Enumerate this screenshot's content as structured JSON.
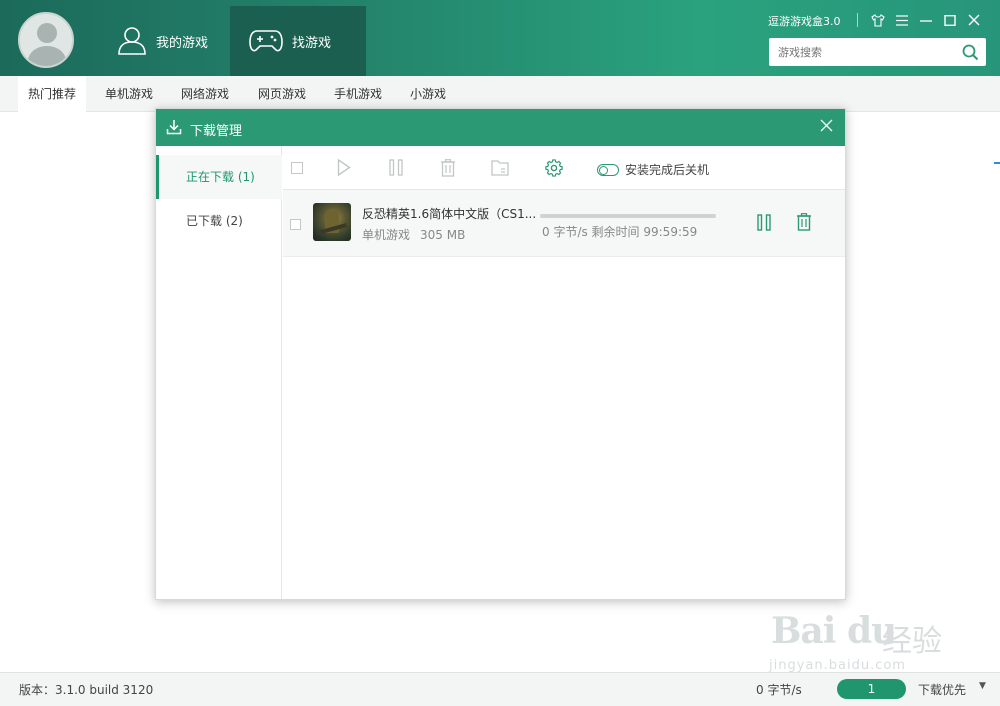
{
  "header": {
    "nav": [
      {
        "label": "我的游戏"
      },
      {
        "label": "找游戏"
      }
    ],
    "app_title": "逗游游戏盒3.0",
    "search": {
      "placeholder": "游戏搜索"
    }
  },
  "subnav": {
    "tabs": [
      {
        "label": "热门推荐"
      },
      {
        "label": "单机游戏"
      },
      {
        "label": "网络游戏"
      },
      {
        "label": "网页游戏"
      },
      {
        "label": "手机游戏"
      },
      {
        "label": "小游戏"
      }
    ]
  },
  "dialog": {
    "title": "下载管理",
    "sidebar": [
      {
        "label": "正在下载 (1)"
      },
      {
        "label": "已下载 (2)"
      }
    ],
    "toolbar": {
      "shutdown_label": "安装完成后关机"
    },
    "items": [
      {
        "name": "反恐精英1.6简体中文版（CS1...",
        "category": "单机游戏",
        "size": "305 MB",
        "status": "0 字节/s 剩余时间 99:59:59",
        "progress": 0
      }
    ]
  },
  "statusbar": {
    "version": "版本：3.1.0 build 3120",
    "speed": "0 字节/s",
    "count": "1",
    "priority": "下载优先"
  },
  "watermark": {
    "text": "Bai du",
    "cn": "经验",
    "url": "jingyan.baidu.com"
  },
  "colors": {
    "brand_green": "#2b9a74",
    "header_dark": "#1a5f4f"
  }
}
